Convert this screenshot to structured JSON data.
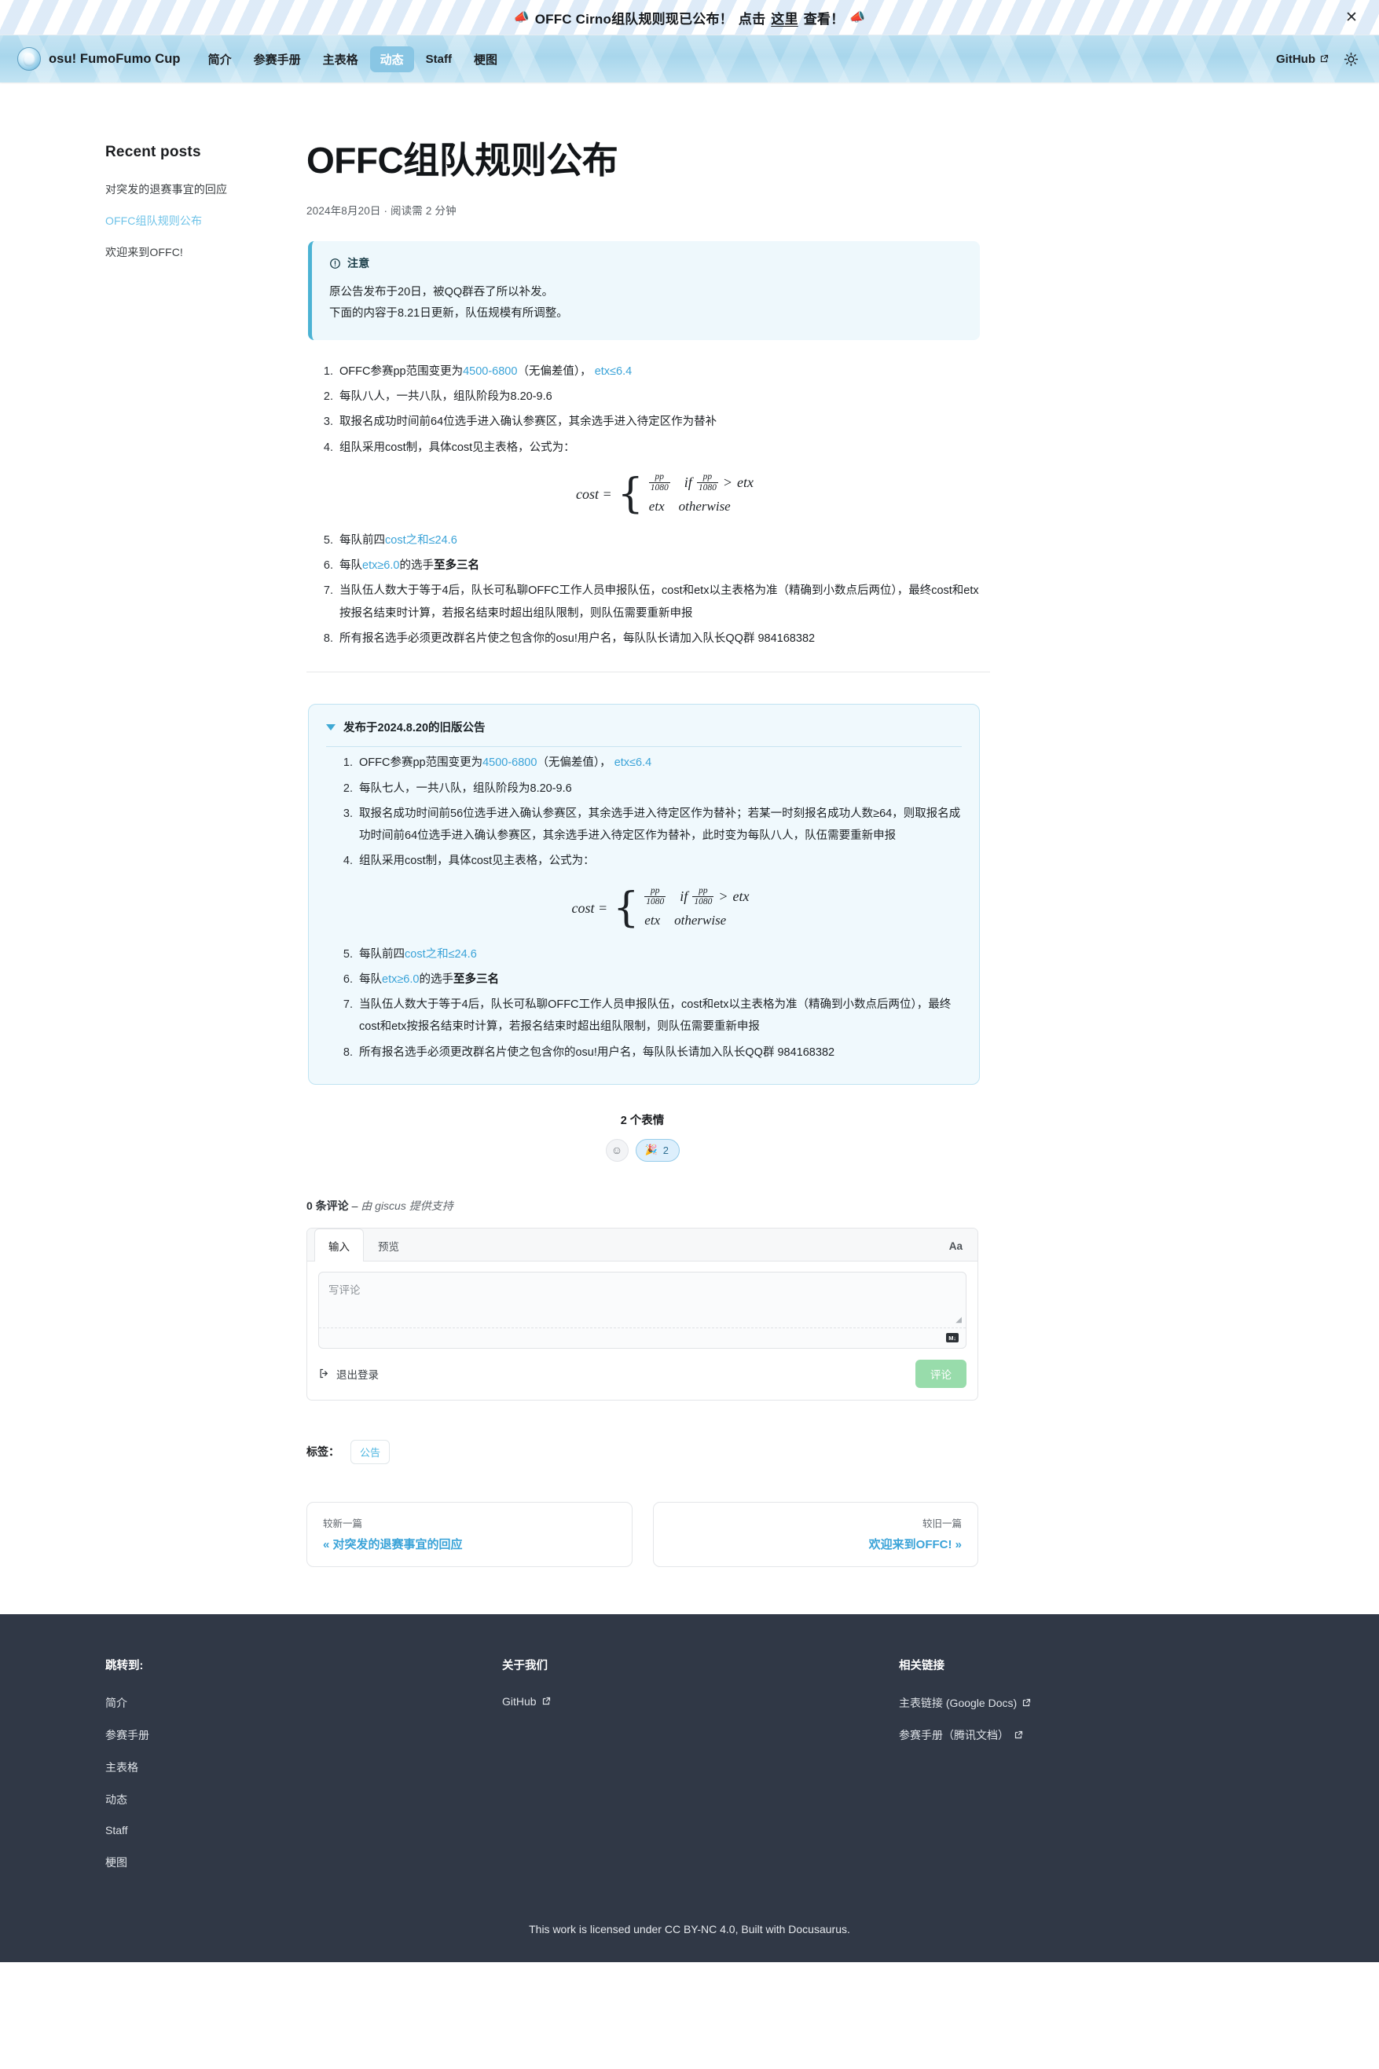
{
  "announcement": {
    "icon": "megaphone-icon",
    "text_before": "OFFC Cirno组队规则现已公布！",
    "click_label": "点击",
    "link_label": "这里",
    "text_after": "查看！",
    "close_label": "✕"
  },
  "navbar": {
    "brand": "osu! FumoFumo Cup",
    "items": [
      {
        "label": "简介",
        "active": false
      },
      {
        "label": "参赛手册",
        "active": false
      },
      {
        "label": "主表格",
        "active": false
      },
      {
        "label": "动态",
        "active": true
      },
      {
        "label": "Staff",
        "active": false
      },
      {
        "label": "梗图",
        "active": false
      }
    ],
    "github_label": "GitHub",
    "theme_toggle": "sun-icon"
  },
  "sidebar": {
    "title": "Recent posts",
    "items": [
      {
        "label": "对突发的退赛事宜的回应",
        "active": false
      },
      {
        "label": "OFFC组队规则公布",
        "active": true
      },
      {
        "label": "欢迎来到OFFC!",
        "active": false
      }
    ]
  },
  "post": {
    "title": "OFFC组队规则公布",
    "meta": "2024年8月20日 · 阅读需 2 分钟",
    "admonition": {
      "type_label": "注意",
      "icon": "info-circle-icon",
      "lines": [
        "原公告发布于20日，被QQ群吞了所以补发。",
        "下面的内容于8.21日更新，队伍规模有所调整。"
      ]
    },
    "rules": {
      "r1_a": "OFFC参赛pp范围变更为",
      "r1_link1": "4500-6800",
      "r1_b": "（无偏差值），",
      "r1_link2": "etx≤6.4",
      "r2": "每队八人，一共八队，组队阶段为8.20-9.6",
      "r3": "取报名成功时间前64位选手进入确认参赛区，其余选手进入待定区作为替补",
      "r4": "组队采用cost制，具体cost见主表格，公式为：",
      "r5_a": "每队前四",
      "r5_link": "cost之和≤24.6",
      "r6_a": "每队",
      "r6_link": "etx≥6.0",
      "r6_b": "的选手",
      "r6_bold": "至多三名",
      "r7": "当队伍人数大于等于4后，队长可私聊OFFC工作人员申报队伍，cost和etx以主表格为准（精确到小数点后两位），最终cost和etx按报名结束时计算，若报名结束时超出组队限制，则队伍需要重新申报",
      "r8": "所有报名选手必须更改群名片使之包含你的osu!用户名，每队队长请加入队长QQ群 984168382"
    },
    "formula": {
      "lhs": "cost =",
      "num": "pp",
      "den": "1080",
      "if_word": "if",
      "gt": ">",
      "etx": "etx",
      "otherwise": "otherwise"
    },
    "details": {
      "summary": "发布于2024.8.20的旧版公告",
      "rules": {
        "r1_a": "OFFC参赛pp范围变更为",
        "r1_link1": "4500-6800",
        "r1_b": "（无偏差值），",
        "r1_link2": "etx≤6.4",
        "r2": "每队七人，一共八队，组队阶段为8.20-9.6",
        "r3": "取报名成功时间前56位选手进入确认参赛区，其余选手进入待定区作为替补；若某一时刻报名成功人数≥64，则取报名成功时间前64位选手进入确认参赛区，其余选手进入待定区作为替补，此时变为每队八人，队伍需要重新申报",
        "r4": "组队采用cost制，具体cost见主表格，公式为：",
        "r5_a": "每队前四",
        "r5_link": "cost之和≤24.6",
        "r6_a": "每队",
        "r6_link": "etx≥6.0",
        "r6_b": "的选手",
        "r6_bold": "至多三名",
        "r7": "当队伍人数大于等于4后，队长可私聊OFFC工作人员申报队伍，cost和etx以主表格为准（精确到小数点后两位），最终cost和etx按报名结束时计算，若报名结束时超出组队限制，则队伍需要重新申报",
        "r8": "所有报名选手必须更改群名片使之包含你的osu!用户名，每队队长请加入队长QQ群 984168382"
      }
    }
  },
  "reactions": {
    "count_label": "2 个表情",
    "add_icon": "smiley-plus-icon",
    "items": [
      {
        "emoji": "🎉",
        "name": "party-popper-reaction",
        "count": "2"
      }
    ]
  },
  "comments": {
    "count_label": "0 条评论",
    "dash": "–",
    "powered_by": "由 giscus 提供支持",
    "tabs": [
      {
        "label": "输入",
        "active": true
      },
      {
        "label": "预览",
        "active": false
      }
    ],
    "font_toggle": "Aa",
    "placeholder": "写评论",
    "markdown_badge": "M↓",
    "signout_label": "退出登录",
    "submit_label": "评论"
  },
  "tags": {
    "label": "标签：",
    "items": [
      {
        "label": "公告"
      }
    ]
  },
  "pager": {
    "prev_label": "较新一篇",
    "prev_title": "« 对突发的退赛事宜的回应",
    "next_label": "较旧一篇",
    "next_title": "欢迎来到OFFC! »"
  },
  "footer": {
    "columns": [
      {
        "title": "跳转到:",
        "links": [
          {
            "label": "简介",
            "external": false
          },
          {
            "label": "参赛手册",
            "external": false
          },
          {
            "label": "主表格",
            "external": false
          },
          {
            "label": "动态",
            "external": false
          },
          {
            "label": "Staff",
            "external": false
          },
          {
            "label": "梗图",
            "external": false
          }
        ]
      },
      {
        "title": "关于我们",
        "links": [
          {
            "label": "GitHub",
            "external": true
          }
        ]
      },
      {
        "title": "相关链接",
        "links": [
          {
            "label": "主表链接 (Google Docs)",
            "external": true
          },
          {
            "label": "参赛手册（腾讯文档）",
            "external": true
          }
        ]
      }
    ],
    "copyright": "This work is licensed under CC BY-NC 4.0, Built with Docusaurus."
  },
  "colors": {
    "accent": "#3aa3d8",
    "nav_bg": "#a8d6ec",
    "nav_active": "#89c6e4",
    "admonition_bg": "#eef8fc",
    "admonition_border": "#4cb3d4",
    "details_bg": "#f0f9fd",
    "footer_bg": "#303846",
    "submit_green": "#98dcab"
  }
}
